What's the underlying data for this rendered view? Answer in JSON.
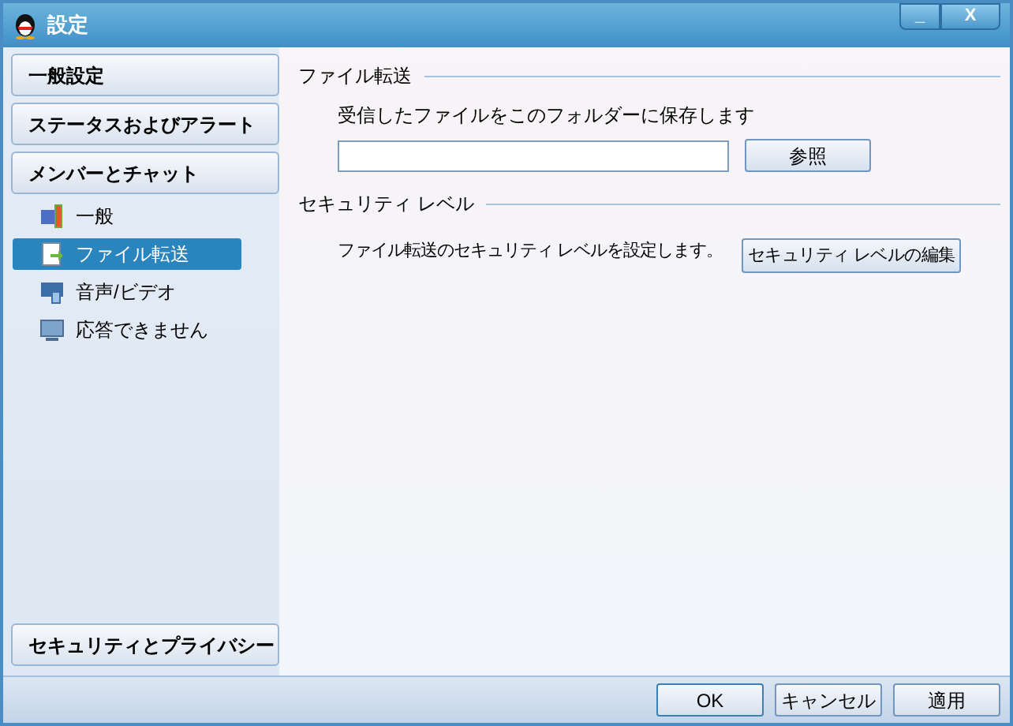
{
  "window": {
    "title": "設定",
    "buttons": [
      "_",
      "X"
    ]
  },
  "sidebar": {
    "items": [
      {
        "kind": "section",
        "label": "一般設定"
      },
      {
        "kind": "section",
        "label": "ステータスおよびアラート"
      },
      {
        "kind": "section",
        "label": "メンバーとチャット"
      },
      {
        "kind": "page",
        "label": "一般",
        "selected": false
      },
      {
        "kind": "page",
        "label": "ファイル転送",
        "selected": true
      },
      {
        "kind": "page",
        "label": "音声/ビデオ",
        "selected": false
      },
      {
        "kind": "page",
        "label": "応答できません",
        "selected": false
      }
    ],
    "bottom": "セキュリティとプライバシー"
  },
  "content": {
    "sections": [
      {
        "title": "ファイル転送",
        "text": "受信したファイルをこのフォルダーに保存します",
        "kind": "folder",
        "button": "参照"
      },
      {
        "title": "セキュリティ レベル",
        "text": "ファイル転送のセキュリティ レベルを設定します。",
        "kind": "action",
        "button": "セキュリティ レベルの編集"
      }
    ]
  },
  "footer": {
    "buttons": [
      "OK",
      "キャンセル",
      "適用"
    ]
  }
}
